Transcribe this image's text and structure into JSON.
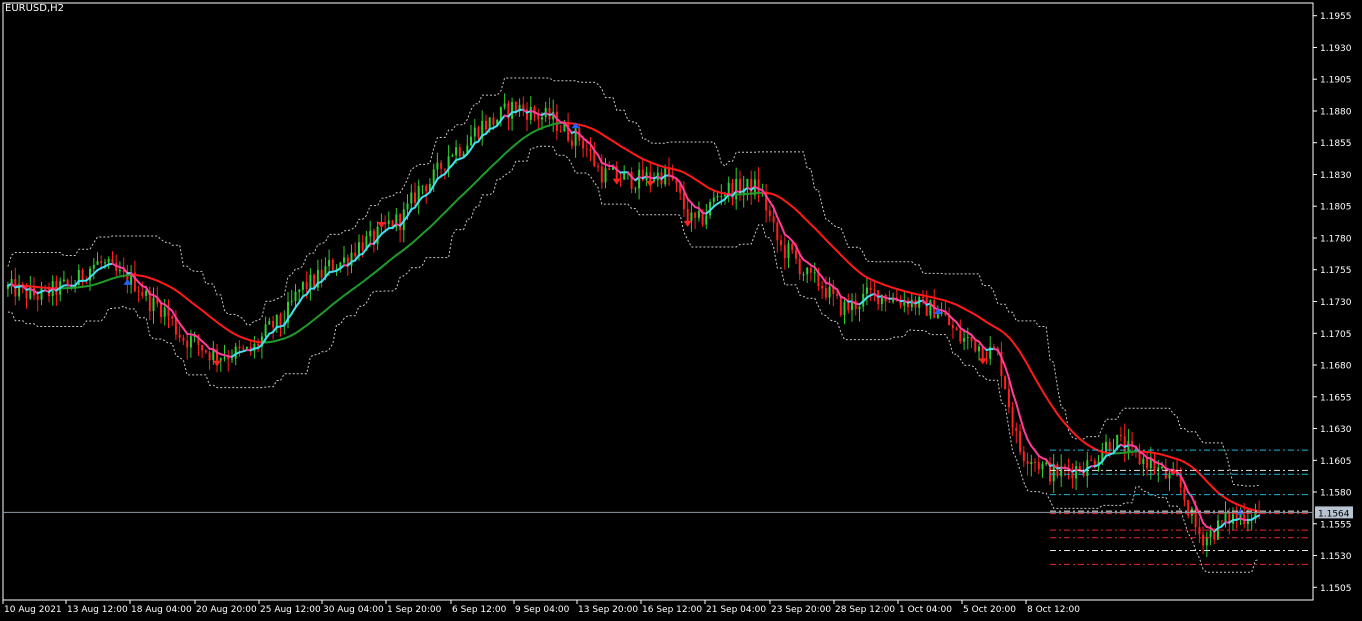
{
  "symbol_label": "EURUSD,H2",
  "colors": {
    "background": "#000000",
    "frame": "#ffffff",
    "axis_text": "#ffffff",
    "bull_bar": "#32cd32",
    "bear_bar": "#ff2020",
    "fast_up": "#40e0f0",
    "fast_down": "#ff3c9a",
    "slow_up": "#1f9a2a",
    "slow_down": "#ff1a1a",
    "band": "#c8c8c8",
    "price_line": "#8c9aa8",
    "price_box": "#b8c4d0",
    "level_cyan": "#19b7d8",
    "level_white": "#e8e8e8",
    "level_red": "#e8282c",
    "buy_arrow": "#2060ff",
    "sell_arrow": "#ff2020"
  },
  "chart_data": {
    "type": "candlestick",
    "symbol": "EURUSD",
    "timeframe": "H2",
    "ylim": [
      1.1495,
      1.1965
    ],
    "y_ticks": [
      1.1955,
      1.193,
      1.1905,
      1.188,
      1.1855,
      1.183,
      1.1805,
      1.178,
      1.1755,
      1.173,
      1.1705,
      1.168,
      1.1655,
      1.163,
      1.1605,
      1.158,
      1.1555,
      1.153,
      1.1505
    ],
    "y_tick_labels": [
      "1.1955",
      "1.1930",
      "1.1905",
      "1.1880",
      "1.1855",
      "1.1830",
      "1.1805",
      "1.1780",
      "1.1755",
      "1.1730",
      "1.1705",
      "1.1680",
      "1.1655",
      "1.1630",
      "1.1605",
      "1.1580",
      "1.1555",
      "1.1530",
      "1.1505"
    ],
    "x_labels": [
      "10 Aug 2021",
      "13 Aug 12:00",
      "18 Aug 04:00",
      "20 Aug 20:00",
      "25 Aug 12:00",
      "30 Aug 04:00",
      "1 Sep 20:00",
      "6 Sep 12:00",
      "9 Sep 04:00",
      "13 Sep 20:00",
      "16 Sep 12:00",
      "21 Sep 04:00",
      "23 Sep 20:00",
      "28 Sep 12:00",
      "1 Oct 04:00",
      "5 Oct 20:00",
      "8 Oct 12:00"
    ],
    "bars_count": 336,
    "current_price": 1.1564,
    "current_price_label": "1.1564",
    "path_keys": [
      [
        0,
        1.174
      ],
      [
        10,
        1.1735
      ],
      [
        20,
        1.1742
      ],
      [
        30,
        1.176
      ],
      [
        40,
        1.1748
      ],
      [
        50,
        1.1727
      ],
      [
        60,
        1.17
      ],
      [
        70,
        1.1688
      ],
      [
        80,
        1.169
      ],
      [
        90,
        1.1712
      ],
      [
        100,
        1.1743
      ],
      [
        110,
        1.176
      ],
      [
        120,
        1.1777
      ],
      [
        130,
        1.1793
      ],
      [
        140,
        1.1823
      ],
      [
        150,
        1.185
      ],
      [
        160,
        1.187
      ],
      [
        170,
        1.1883
      ],
      [
        180,
        1.1875
      ],
      [
        190,
        1.186
      ],
      [
        200,
        1.183
      ],
      [
        210,
        1.1826
      ],
      [
        220,
        1.183
      ],
      [
        230,
        1.1792
      ],
      [
        240,
        1.1818
      ],
      [
        250,
        1.182
      ],
      [
        260,
        1.177
      ],
      [
        270,
        1.1746
      ],
      [
        280,
        1.1725
      ],
      [
        290,
        1.1736
      ],
      [
        300,
        1.1731
      ],
      [
        310,
        1.1724
      ],
      [
        320,
        1.17
      ],
      [
        330,
        1.169
      ],
      [
        340,
        1.161
      ],
      [
        350,
        1.1595
      ],
      [
        360,
        1.16
      ],
      [
        370,
        1.162
      ],
      [
        380,
        1.1605
      ],
      [
        390,
        1.159
      ],
      [
        400,
        1.1545
      ],
      [
        410,
        1.156
      ],
      [
        420,
        1.1565
      ]
    ],
    "levels": [
      {
        "price": 1.1613,
        "color": "cyan"
      },
      {
        "price": 1.1597,
        "color": "white"
      },
      {
        "price": 1.1594,
        "color": "cyan"
      },
      {
        "price": 1.1578,
        "color": "cyan"
      },
      {
        "price": 1.1565,
        "color": "white"
      },
      {
        "price": 1.1563,
        "color": "red"
      },
      {
        "price": 1.155,
        "color": "red"
      },
      {
        "price": 1.1544,
        "color": "red"
      },
      {
        "price": 1.1534,
        "color": "white"
      },
      {
        "price": 1.1523,
        "color": "red"
      }
    ],
    "signals": [
      {
        "bar": 62,
        "type": "buy"
      },
      {
        "bar": 110,
        "type": "sell"
      },
      {
        "bar": 197,
        "type": "sell"
      },
      {
        "bar": 298,
        "type": "buy"
      },
      {
        "bar": 320,
        "type": "sell"
      },
      {
        "bar": 338,
        "type": "sell"
      },
      {
        "bar": 357,
        "type": "sell"
      },
      {
        "bar": 490,
        "type": "buy"
      },
      {
        "bar": 512,
        "type": "sell"
      },
      {
        "bar": 612,
        "type": "sell"
      },
      {
        "bar": 649,
        "type": "buy"
      }
    ]
  }
}
